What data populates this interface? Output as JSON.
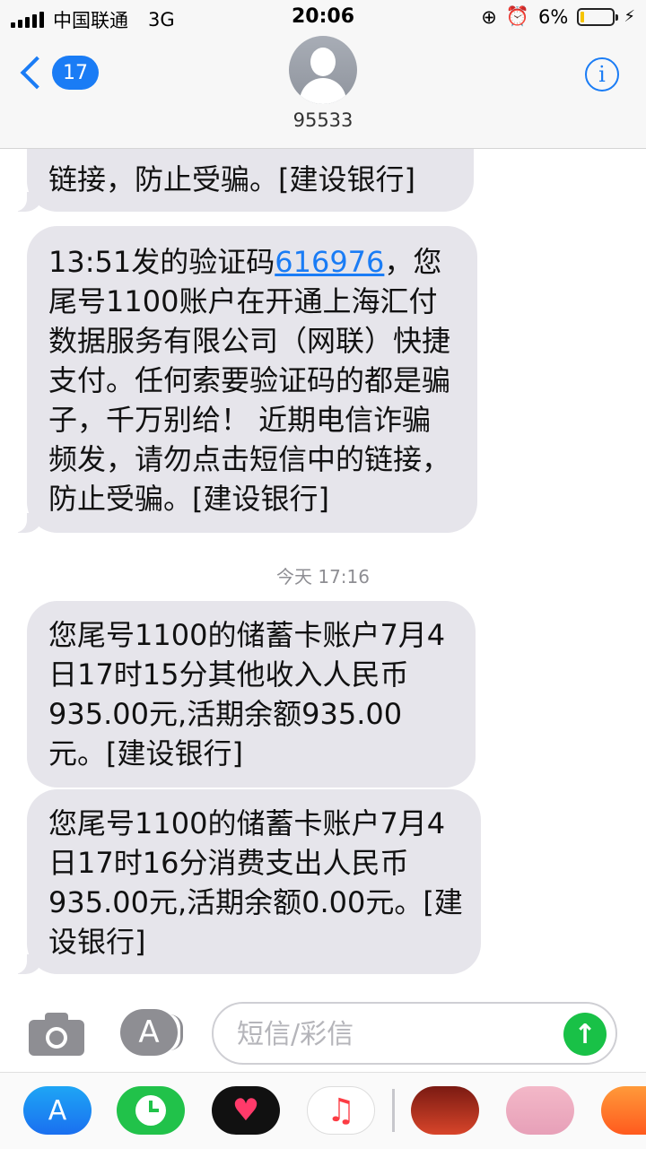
{
  "status_bar": {
    "carrier": "中国联通",
    "network": "3G",
    "time": "20:06",
    "battery_percent": "6%",
    "battery_level": 0.06,
    "icons": [
      "signal-icon",
      "rotation-lock-icon",
      "alarm-icon",
      "battery-icon",
      "charging-bolt-icon"
    ]
  },
  "header": {
    "back_count": "17",
    "contact_name": "95533",
    "info_glyph": "i"
  },
  "thread": {
    "partial_message": "链接，防止受骗。[建设银行]",
    "message1": {
      "prefix": "13:51发的验证码",
      "code": "616976",
      "suffix": "，您尾号1100账户在开通上海汇付数据服务有限公司（网联）快捷支付。任何索要验证码的都是骗子，千万别给！  近期电信诈骗频发，请勿点击短信中的链接，防止受骗。[建设银行]"
    },
    "timestamp": "今天 17:16",
    "message2": "您尾号1100的储蓄卡账户7月4日17时15分其他收入人民币935.00元,活期余额935.00元。[建设银行]",
    "message3": "您尾号1100的储蓄卡账户7月4日17时16分消费支出人民币935.00元,活期余额0.00元。[建设银行]"
  },
  "composer": {
    "placeholder": "短信/彩信",
    "send_glyph": "↑"
  },
  "app_drawer": {
    "apps": [
      "app-store-icon",
      "clock-icon",
      "digital-touch-icon",
      "music-icon",
      "sticker-pack-icon",
      "sticker-pack-icon",
      "app-icon"
    ]
  }
}
